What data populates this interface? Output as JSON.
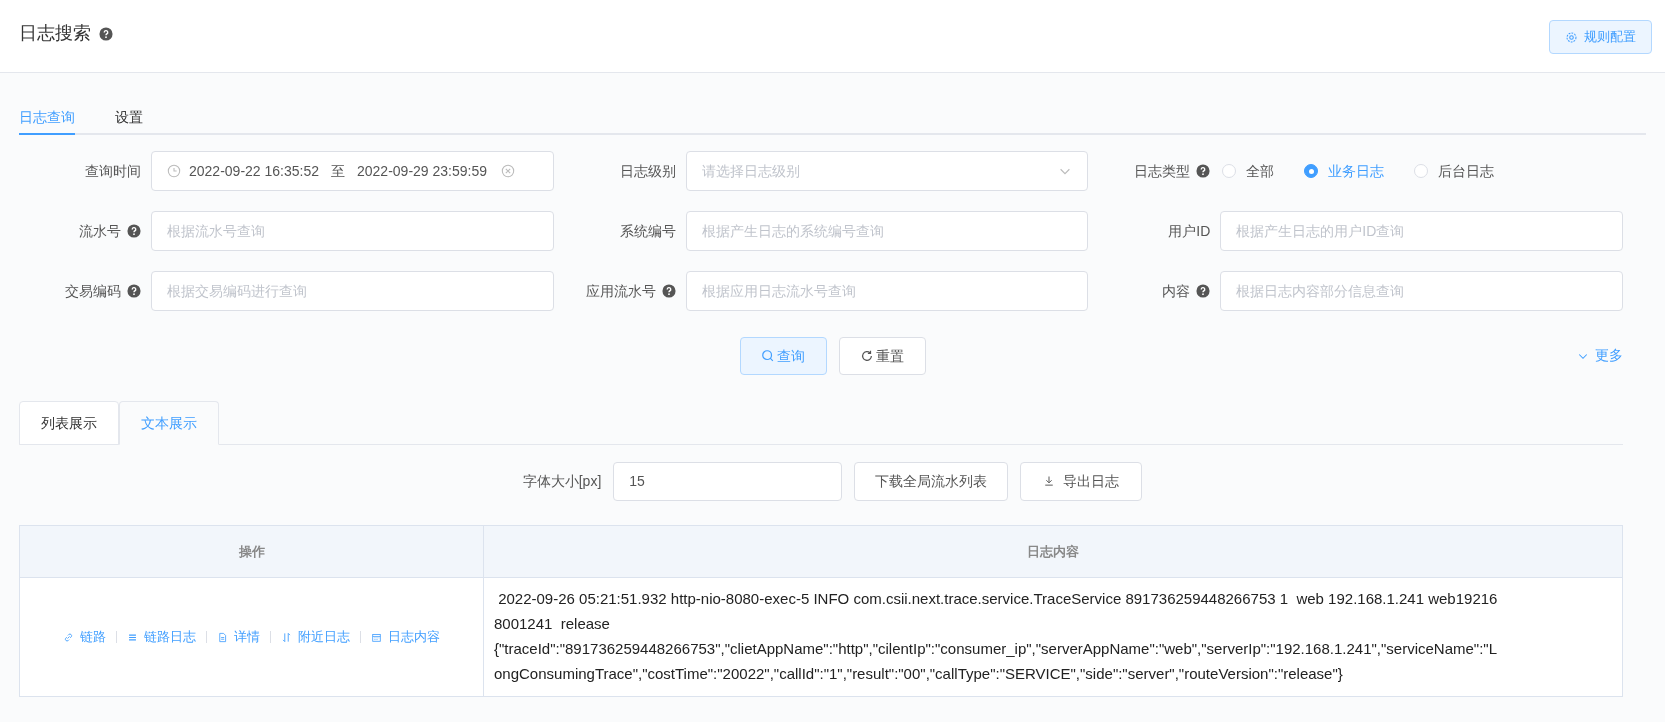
{
  "header": {
    "title": "日志搜索",
    "rule_button": "规则配置"
  },
  "tabs": [
    {
      "label": "日志查询",
      "selected": true
    },
    {
      "label": "设置",
      "selected": false
    }
  ],
  "fields": [
    {
      "kind": "daterange",
      "label": "查询时间",
      "help": false,
      "start": "2022-09-22 16:35:52",
      "separator": "至",
      "end": "2022-09-29 23:59:59"
    },
    {
      "kind": "select",
      "label": "日志级别",
      "help": false,
      "placeholder": "请选择日志级别"
    },
    {
      "kind": "radio",
      "label": "日志类型",
      "help": true,
      "options": [
        {
          "label": "全部",
          "selected": false
        },
        {
          "label": "业务日志",
          "selected": true
        },
        {
          "label": "后台日志",
          "selected": false
        }
      ]
    },
    {
      "kind": "text",
      "label": "流水号",
      "help": true,
      "placeholder": "根据流水号查询"
    },
    {
      "kind": "text",
      "label": "系统编号",
      "help": false,
      "placeholder": "根据产生日志的系统编号查询"
    },
    {
      "kind": "text",
      "label": "用户ID",
      "help": false,
      "placeholder": "根据产生日志的用户ID查询"
    },
    {
      "kind": "text",
      "label": "交易编码",
      "help": true,
      "placeholder": "根据交易编码进行查询"
    },
    {
      "kind": "text",
      "label": "应用流水号",
      "help": true,
      "placeholder": "根据应用日志流水号查询"
    },
    {
      "kind": "text",
      "label": "内容",
      "help": true,
      "placeholder": "根据日志内容部分信息查询"
    }
  ],
  "actions": {
    "query": "查询",
    "reset": "重置",
    "more": "更多"
  },
  "view_tabs": [
    {
      "label": "列表展示",
      "selected": false
    },
    {
      "label": "文本展示",
      "selected": true
    }
  ],
  "toolbar": {
    "font_size_label": "字体大小[px]",
    "font_size": "15",
    "download": "下载全局流水列表",
    "export": "导出日志"
  },
  "table": {
    "columns": [
      "操作",
      "日志内容"
    ],
    "rows": [
      {
        "ops": [
          {
            "kind": "link",
            "label": "链路"
          },
          {
            "kind": "list",
            "label": "链路日志"
          },
          {
            "kind": "doc",
            "label": "详情"
          },
          {
            "kind": "sort",
            "label": "附近日志"
          },
          {
            "kind": "calendar",
            "label": "日志内容"
          }
        ],
        "lines": [
          " 2022-09-26 05:21:51.932 http-nio-8080-exec-5 INFO com.csii.next.trace.service.TraceService 891736259448266753 1  web 192.168.1.241 web19216",
          "8001241  release",
          "{\"traceId\":\"891736259448266753\",\"clietAppName\":\"http\",\"cilentIp\":\"consumer_ip\",\"serverAppName\":\"web\",\"serverIp\":\"192.168.1.241\",\"serviceName\":\"L",
          "ongConsumingTrace\",\"costTime\":\"20022\",\"callId\":\"1\",\"result\":\"00\",\"callType\":\"SERVICE\",\"side\":\"server\",\"routeVersion\":\"release\"}"
        ]
      }
    ]
  }
}
